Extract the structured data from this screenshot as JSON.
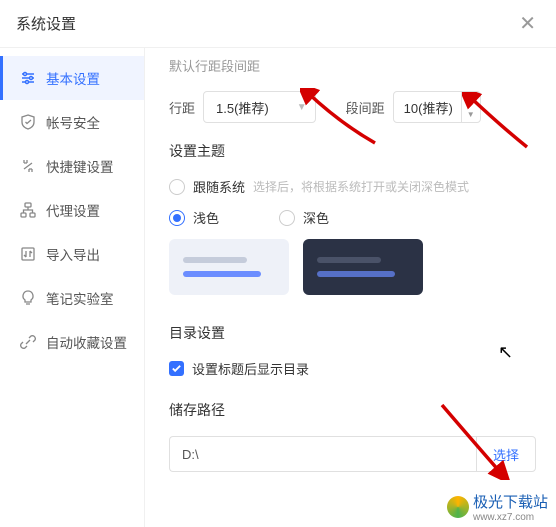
{
  "header": {
    "title": "系统设置"
  },
  "sidebar": {
    "items": [
      {
        "label": "基本设置"
      },
      {
        "label": "帐号安全"
      },
      {
        "label": "快捷键设置"
      },
      {
        "label": "代理设置"
      },
      {
        "label": "导入导出"
      },
      {
        "label": "笔记实验室"
      },
      {
        "label": "自动收藏设置"
      }
    ]
  },
  "main": {
    "section0_title": "默认行距段间距",
    "line_spacing_label": "行距",
    "line_spacing_value": "1.5(推荐)",
    "para_spacing_label": "段间距",
    "para_spacing_value": "10(推荐)",
    "theme_section_title": "设置主题",
    "theme_follow_system": "跟随系统",
    "theme_follow_hint": "选择后，将根据系统打开或关闭深色模式",
    "theme_light": "浅色",
    "theme_dark": "深色",
    "dir_section_title": "目录设置",
    "dir_checkbox_label": "设置标题后显示目录",
    "path_section_title": "储存路径",
    "path_value": "D:\\",
    "path_button": "选择"
  },
  "watermark": {
    "text": "极光下载站",
    "url": "www.xz7.com"
  }
}
